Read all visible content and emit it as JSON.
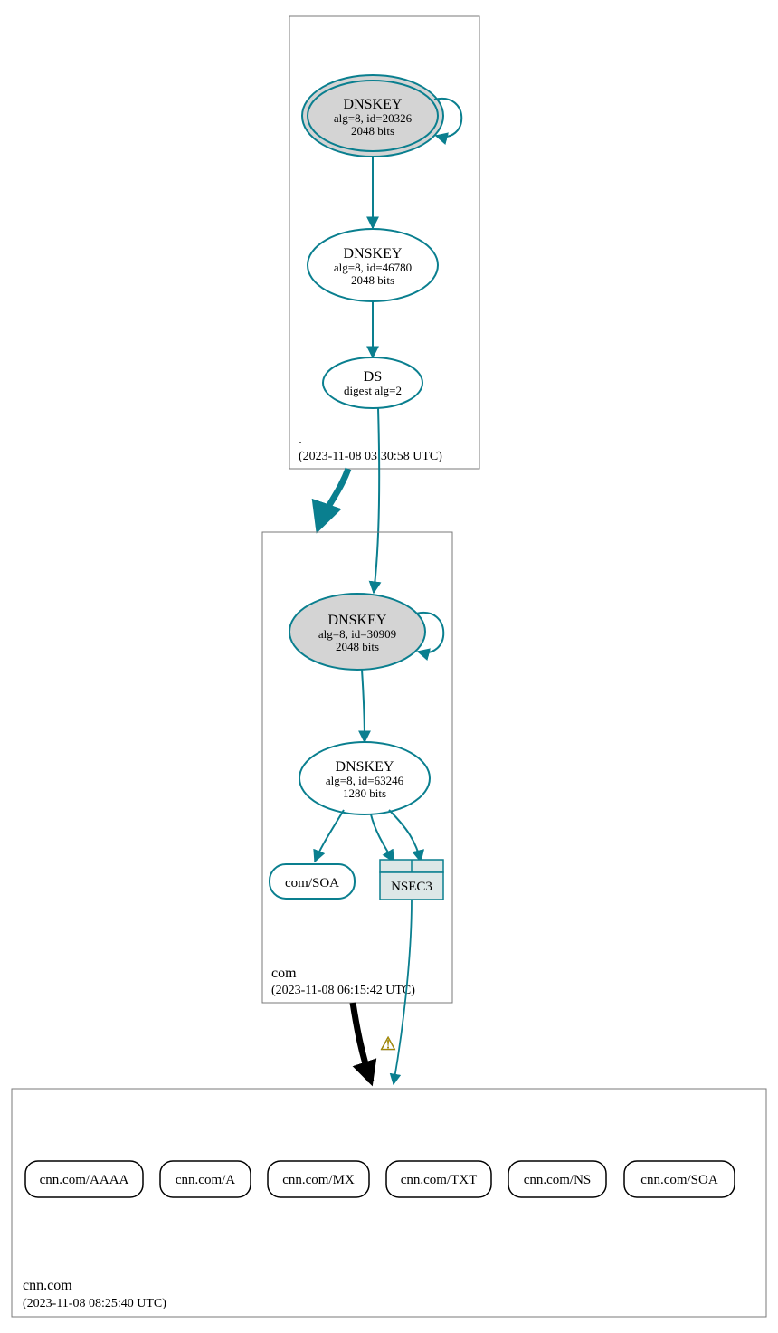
{
  "colors": {
    "teal": "#0a7f8f",
    "grey": "#d4d4d4",
    "black": "#000000"
  },
  "zones": [
    {
      "name": ".",
      "timestamp": "(2023-11-08 03:30:58 UTC)",
      "nodes": {
        "ksk": {
          "title": "DNSKEY",
          "line2": "alg=8, id=20326",
          "line3": "2048 bits"
        },
        "zsk": {
          "title": "DNSKEY",
          "line2": "alg=8, id=46780",
          "line3": "2048 bits"
        },
        "ds": {
          "title": "DS",
          "line2": "digest alg=2"
        }
      }
    },
    {
      "name": "com",
      "timestamp": "(2023-11-08 06:15:42 UTC)",
      "nodes": {
        "ksk": {
          "title": "DNSKEY",
          "line2": "alg=8, id=30909",
          "line3": "2048 bits"
        },
        "zsk": {
          "title": "DNSKEY",
          "line2": "alg=8, id=63246",
          "line3": "1280 bits"
        },
        "soa": {
          "label": "com/SOA"
        },
        "nsec": {
          "label": "NSEC3"
        }
      }
    },
    {
      "name": "cnn.com",
      "timestamp": "(2023-11-08 08:25:40 UTC)",
      "records": [
        "cnn.com/AAAA",
        "cnn.com/A",
        "cnn.com/MX",
        "cnn.com/TXT",
        "cnn.com/NS",
        "cnn.com/SOA"
      ]
    }
  ],
  "warning_icon": "⚠"
}
